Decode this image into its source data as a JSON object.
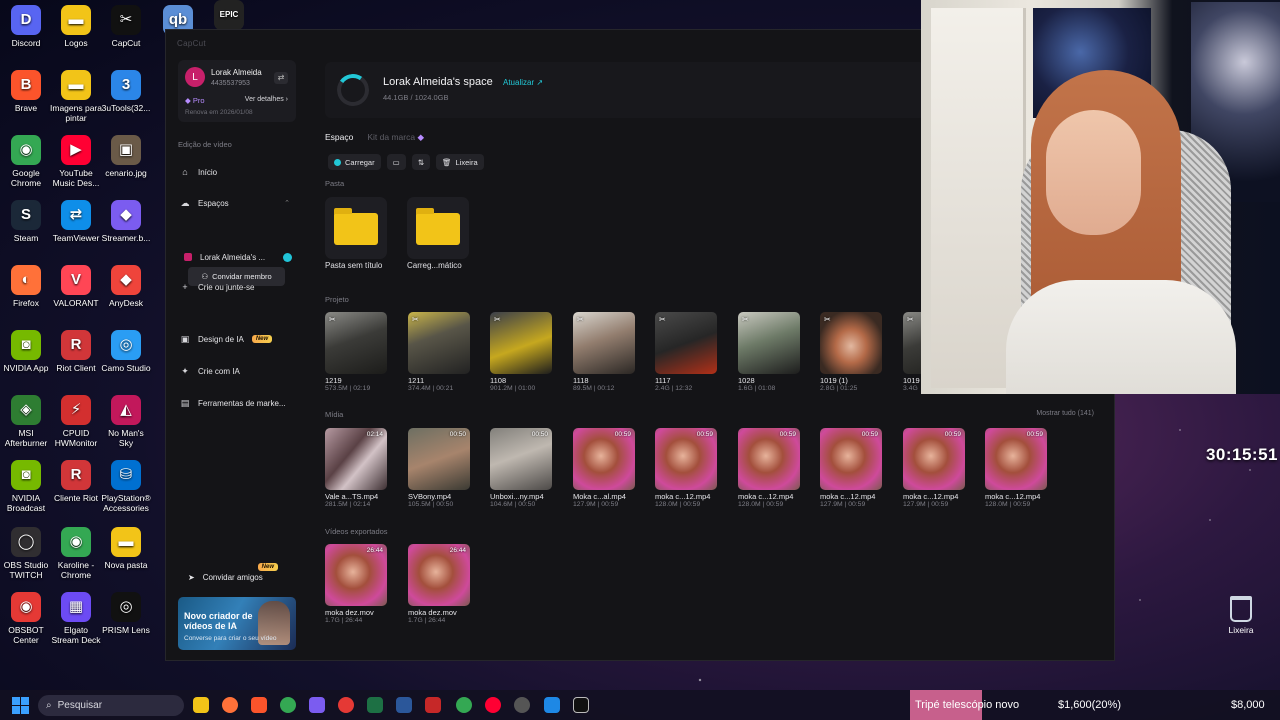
{
  "desktop": {
    "icons": [
      {
        "label": "Discord",
        "color": "#5865f2",
        "glyph": "D"
      },
      {
        "label": "Logos",
        "color": "#f2c418",
        "glyph": "▬"
      },
      {
        "label": "CapCut",
        "color": "#111111",
        "glyph": "✂"
      },
      {
        "label": "qb",
        "color": "#5b8ed6",
        "glyph": "qb"
      },
      {
        "label": "",
        "color": "#222222",
        "glyph": "EPIC"
      },
      {
        "label": "Brave",
        "color": "#fb542b",
        "glyph": "B"
      },
      {
        "label": "Imagens para pintar",
        "color": "#f2c418",
        "glyph": "▬"
      },
      {
        "label": "3uTools(32...",
        "color": "#2b86e8",
        "glyph": "3"
      },
      {
        "label": "Google Chrome",
        "color": "#34a853",
        "glyph": "◉"
      },
      {
        "label": "YouTube Music Des...",
        "color": "#ff0033",
        "glyph": "▶"
      },
      {
        "label": "cenario.jpg",
        "color": "#6a5a48",
        "glyph": "▣"
      },
      {
        "label": "Steam",
        "color": "#1b2838",
        "glyph": "S"
      },
      {
        "label": "TeamViewer",
        "color": "#0e8ee9",
        "glyph": "⇄"
      },
      {
        "label": "Streamer.b...",
        "color": "#7b5cf0",
        "glyph": "◆"
      },
      {
        "label": "Firefox",
        "color": "#ff7139",
        "glyph": "◐"
      },
      {
        "label": "VALORANT",
        "color": "#ff4655",
        "glyph": "V"
      },
      {
        "label": "AnyDesk",
        "color": "#ef443b",
        "glyph": "◆"
      },
      {
        "label": "NVIDIA App",
        "color": "#76b900",
        "glyph": "◙"
      },
      {
        "label": "Riot Client",
        "color": "#d13639",
        "glyph": "R"
      },
      {
        "label": "Camo Studio",
        "color": "#2a9df4",
        "glyph": "◎"
      },
      {
        "label": "MSI Afterburner",
        "color": "#2e7d32",
        "glyph": "◈"
      },
      {
        "label": "CPUID HWMonitor",
        "color": "#d32f2f",
        "glyph": "⚡"
      },
      {
        "label": "No Man's Sky",
        "color": "#c2185b",
        "glyph": "◭"
      },
      {
        "label": "NVIDIA Broadcast",
        "color": "#76b900",
        "glyph": "◙"
      },
      {
        "label": "Cliente Riot",
        "color": "#d13639",
        "glyph": "R"
      },
      {
        "label": "PlayStation® Accessories",
        "color": "#0070d1",
        "glyph": "⛁"
      },
      {
        "label": "OBS Studio TWITCH",
        "color": "#302e31",
        "glyph": "◯"
      },
      {
        "label": "Karoline - Chrome",
        "color": "#34a853",
        "glyph": "◉"
      },
      {
        "label": "Nova pasta",
        "color": "#f2c418",
        "glyph": "▬"
      },
      {
        "label": "OBSBOT Center",
        "color": "#e53935",
        "glyph": "◉"
      },
      {
        "label": "Elgato Stream Deck",
        "color": "#6c4bf4",
        "glyph": "▦"
      },
      {
        "label": "PRISM Lens",
        "color": "#111111",
        "glyph": "◎"
      }
    ],
    "recycle_bin": "Lixeira",
    "timer": "30:15:51"
  },
  "app": {
    "title": "CapCut",
    "user": {
      "name": "Lorak Almeida",
      "id": "4435537953",
      "avatar": "L",
      "plan": "Pro",
      "details": "Ver detalhes",
      "renew": "Renova em 2026/01/08"
    },
    "sidebar": {
      "section": "Edição de vídeo",
      "inicio": "Início",
      "espacos": "Espaços",
      "space_item": "Lorak Almeida's ...",
      "invite_member": "Convidar membro",
      "create_join": "Crie ou junte-se",
      "ai_design": "Design de IA",
      "new_badge": "New",
      "create_ai": "Crie com IA",
      "marketing_tools": "Ferramentas de marke...",
      "invite_friends": "Convidar amigos",
      "promo_title": "Novo criador de vídeos de IA",
      "promo_sub": "Converse para criar o seu vídeo"
    },
    "space": {
      "name": "Lorak Almeida's space",
      "update": "Atualizar ↗",
      "storage": "44.1GB / 1024.0GB",
      "usage_fraction": 0.043
    },
    "tabs": {
      "space": "Espaço",
      "brand_kit": "Kit da marca"
    },
    "toolbar": {
      "upload": "Carregar",
      "trash": "Lixeira"
    },
    "groups": {
      "folders": "Pasta",
      "projects": "Projeto",
      "media": "Mídia",
      "exported": "Vídeos exportados",
      "show_all": "Mostrar tudo (141)"
    },
    "folders": [
      {
        "name": "Pasta sem título"
      },
      {
        "name": "Carreg...mático"
      }
    ],
    "projects": [
      {
        "name": "1219",
        "meta": "573.5M | 02:19",
        "style": "g-gym"
      },
      {
        "name": "1211",
        "meta": "374.4M | 00:21",
        "style": "g-gym2"
      },
      {
        "name": "1108",
        "meta": "901.2M | 01:00",
        "style": "g-gym3"
      },
      {
        "name": "1118",
        "meta": "89.5M | 00:12",
        "style": "g-gym4"
      },
      {
        "name": "1117",
        "meta": "2.4G | 12:32",
        "style": "g-dark"
      },
      {
        "name": "1028",
        "meta": "1.6G | 01:08",
        "style": "g-street"
      },
      {
        "name": "1019 (1)",
        "meta": "2.8G | 01:25",
        "style": "g-face"
      },
      {
        "name": "1019",
        "meta": "3.4G",
        "style": "g-gym"
      }
    ],
    "media": [
      {
        "name": "Vale a...TS.mp4",
        "meta": "281.5M | 02:14",
        "dur": "02:14",
        "style": "g-blur"
      },
      {
        "name": "SVBony.mp4",
        "meta": "105.5M | 00:50",
        "dur": "00:50",
        "style": "g-desk"
      },
      {
        "name": "Unboxi...ny.mp4",
        "meta": "104.6M | 00:50",
        "dur": "00:50",
        "style": "g-room"
      },
      {
        "name": "Moka c...al.mp4",
        "meta": "127.9M | 00:59",
        "dur": "00:59",
        "style": "g-pink"
      },
      {
        "name": "moka c...12.mp4",
        "meta": "128.0M | 00:59",
        "dur": "00:59",
        "style": "g-pink"
      },
      {
        "name": "moka c...12.mp4",
        "meta": "128.0M | 00:59",
        "dur": "00:59",
        "style": "g-pink"
      },
      {
        "name": "moka c...12.mp4",
        "meta": "127.9M | 00:59",
        "dur": "00:59",
        "style": "g-pink"
      },
      {
        "name": "moka c...12.mp4",
        "meta": "127.9M | 00:59",
        "dur": "00:59",
        "style": "g-pink"
      },
      {
        "name": "moka c...12.mp4",
        "meta": "128.0M | 00:59",
        "dur": "00:59",
        "style": "g-pink"
      }
    ],
    "exported": [
      {
        "name": "moka dez.mov",
        "meta": "1.7G | 26:44",
        "dur": "26:44",
        "style": "g-pink"
      },
      {
        "name": "moka dez.mov",
        "meta": "1.7G | 26:44",
        "dur": "26:44",
        "style": "g-pink"
      }
    ]
  },
  "taskbar": {
    "search": "Pesquisar",
    "ticker_1": "Tripé telescópio novo",
    "ticker_2": "$1,600(20%)",
    "ticker_3": "$8,000"
  }
}
